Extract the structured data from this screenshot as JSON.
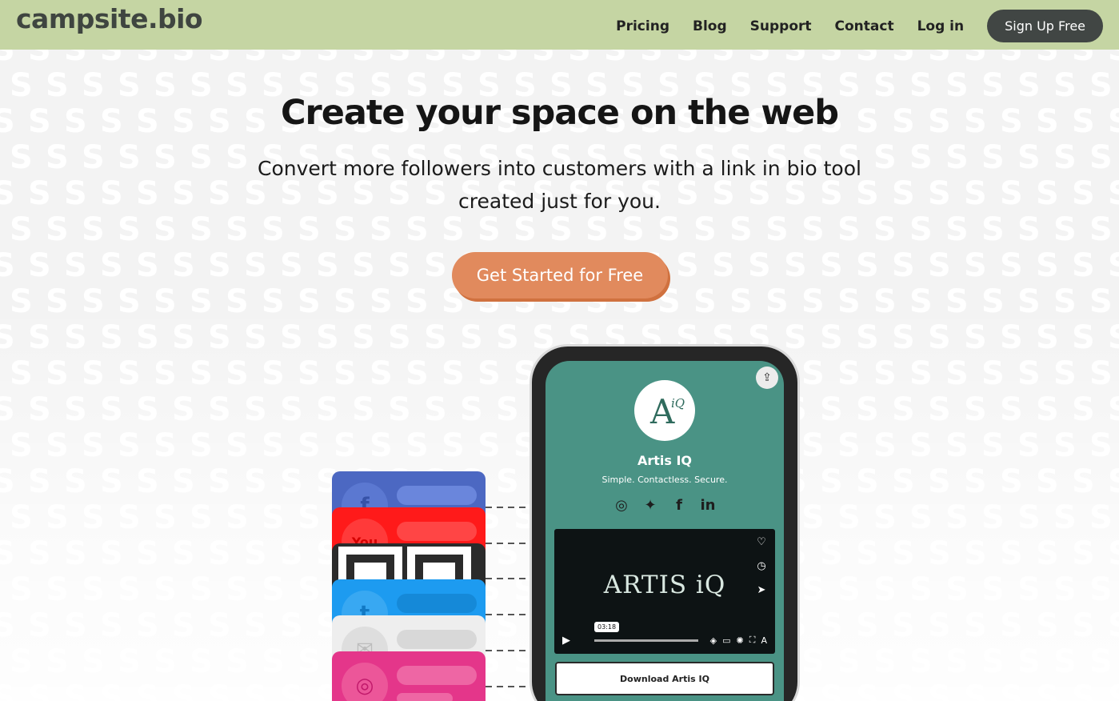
{
  "header": {
    "logo": "campsite.bio",
    "nav": [
      "Pricing",
      "Blog",
      "Support",
      "Contact",
      "Log in"
    ],
    "signup_label": "Sign Up Free"
  },
  "hero": {
    "title": "Create your space on the web",
    "subtitle": "Convert more followers into customers with a link in bio tool created just for you.",
    "cta_label": "Get Started for Free"
  },
  "cards": [
    {
      "name": "facebook",
      "color": "#4c68c2",
      "icon": "f"
    },
    {
      "name": "youtube",
      "color": "#ff1a1a",
      "icon": "You"
    },
    {
      "name": "qr",
      "color": "#2b2b2b",
      "icon": "qr"
    },
    {
      "name": "twitter",
      "color": "#1d9bf0",
      "icon": "twitter-bird"
    },
    {
      "name": "email",
      "color": "#eeeeee",
      "icon": "envelope"
    },
    {
      "name": "instagram",
      "color": "#e4368a",
      "icon": "instagram"
    }
  ],
  "phone": {
    "profile_name": "Artis IQ",
    "tagline": "Simple. Contactless. Secure.",
    "social_icons": [
      "instagram-icon",
      "twitter-icon",
      "facebook-icon",
      "linkedin-icon"
    ],
    "video_title": "ARTIS iQ",
    "video_time": "03:18",
    "download_label": "Download Artis IQ"
  },
  "colors": {
    "header_bg": "#c5d5a3",
    "cta": "#e18a5d",
    "phone_screen": "#4a9385"
  }
}
